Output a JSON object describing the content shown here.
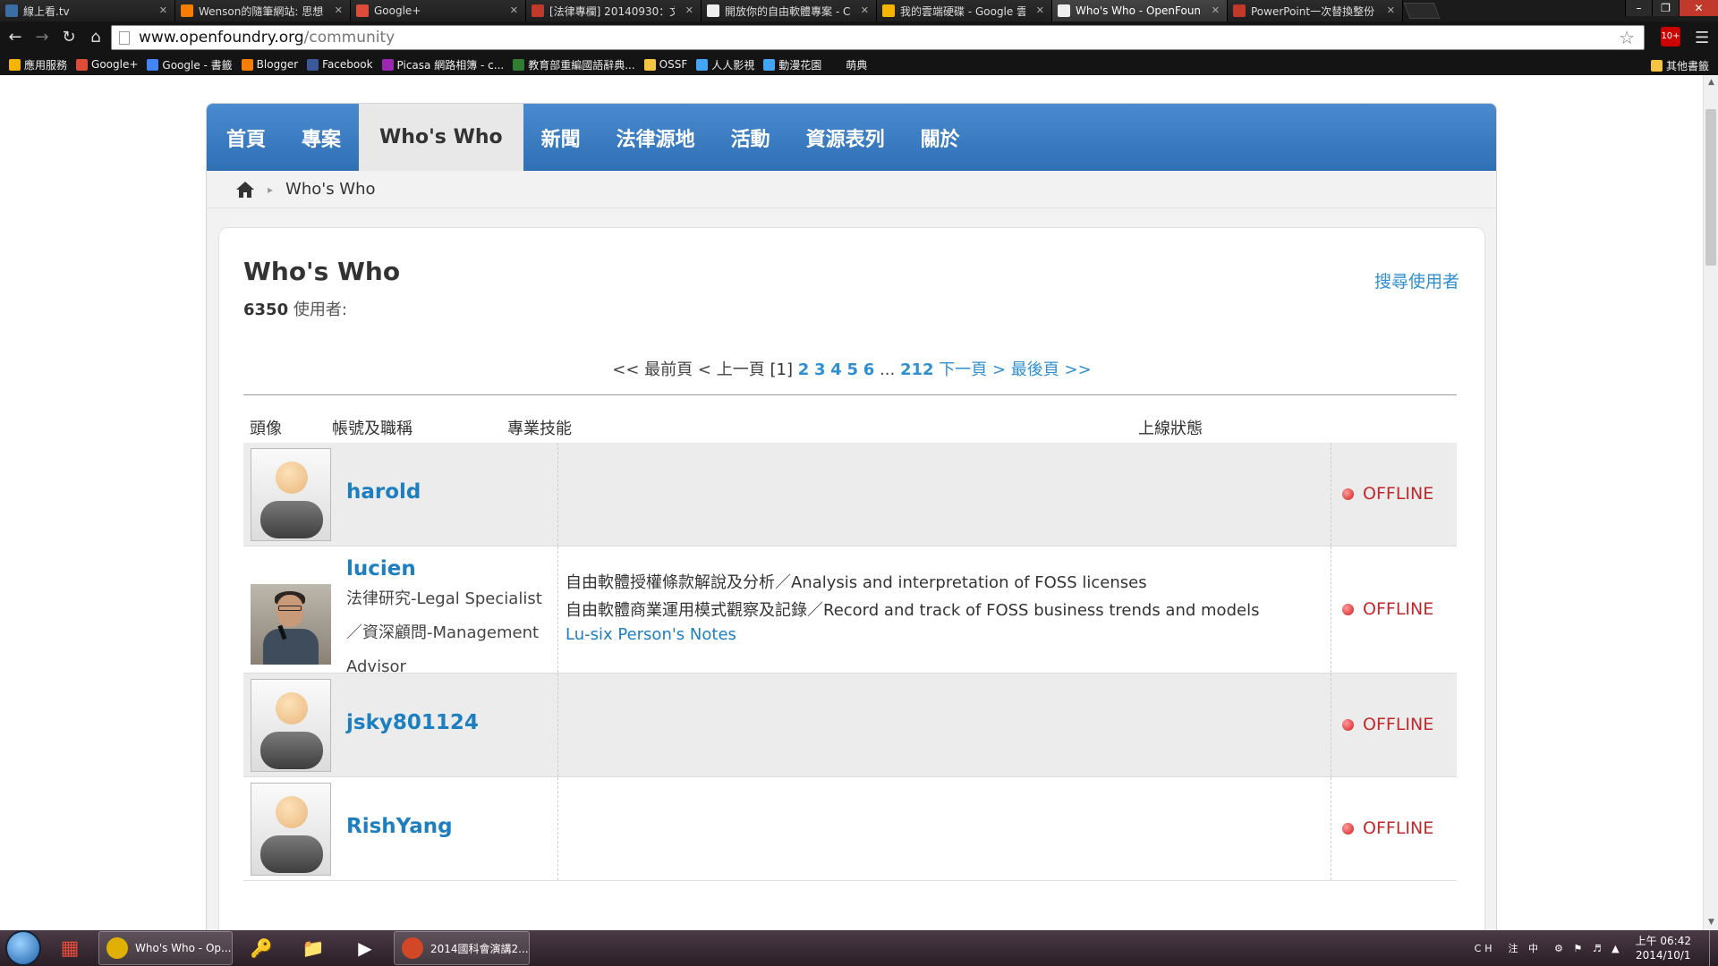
{
  "browser": {
    "tabs": [
      {
        "label": "線上看.tv",
        "icon_color": "#3a6ea5"
      },
      {
        "label": "Wenson的隨筆網站: 思想",
        "icon_color": "#f57d00"
      },
      {
        "label": "Google+",
        "icon_color": "#dd4b39"
      },
      {
        "label": "[法律專欄] 20140930：文",
        "icon_color": "#c0392b"
      },
      {
        "label": "開放你的自由軟體專案 - C",
        "icon_color": "#eeeeee"
      },
      {
        "label": "我的雲端硬碟 - Google 雲",
        "icon_color": "#f4b400"
      },
      {
        "label": "Who's Who - OpenFoun",
        "icon_color": "#eeeeee"
      },
      {
        "label": "PowerPoint一次替換整份",
        "icon_color": "#c0392b"
      }
    ],
    "url_host": "www.openfoundry.org",
    "url_path": "/community",
    "ext_badge": "10+",
    "bookmarks": [
      {
        "label": "應用服務",
        "icon_color": "#f4b400"
      },
      {
        "label": "Google+",
        "icon_color": "#dd4b39"
      },
      {
        "label": "Google - 書籤",
        "icon_color": "#4285f4"
      },
      {
        "label": "Blogger",
        "icon_color": "#f57d00"
      },
      {
        "label": "Facebook",
        "icon_color": "#3b5998"
      },
      {
        "label": "Picasa 網路相簿 - c...",
        "icon_color": "#9c27b0"
      },
      {
        "label": "教育部重編國語辭典...",
        "icon_color": "#2e7d32"
      },
      {
        "label": "OSSF",
        "icon_color": "#f4c542"
      },
      {
        "label": "人人影視",
        "icon_color": "#42a5f5"
      },
      {
        "label": "動漫花園",
        "icon_color": "#42a5f5"
      },
      {
        "label": "萌典",
        "icon_color": "#141414"
      }
    ],
    "other_bookmarks": "其他書籤"
  },
  "site": {
    "nav": [
      "首頁",
      "專案",
      "Who's Who",
      "新聞",
      "法律源地",
      "活動",
      "資源表列",
      "關於"
    ],
    "nav_active": 2,
    "breadcrumb": "Who's Who"
  },
  "directory": {
    "title": "Who's Who",
    "user_count": "6350",
    "user_count_label": "使用者:",
    "search_link": "搜尋使用者",
    "pager": {
      "first": "<< 最前頁",
      "prev": "< 上一頁",
      "current": "[1]",
      "pages": [
        "2",
        "3",
        "4",
        "5",
        "6"
      ],
      "ellipsis": "...",
      "last_page": "212",
      "next": "下一頁 >",
      "last": "最後頁 >>"
    },
    "columns": {
      "avatar": "頭像",
      "account": "帳號及職稱",
      "skills": "專業技能",
      "status": "上線狀態"
    },
    "users": [
      {
        "username": "harold",
        "title_lines": [],
        "skills": [],
        "links": [],
        "status": "OFFLINE",
        "avatar": "default"
      },
      {
        "username": "lucien",
        "title_lines": [
          "法律研究-Legal Specialist",
          "／資深顧問-Management",
          "Advisor"
        ],
        "skills": [
          "自由軟體授權條款解說及分析／Analysis and interpretation of FOSS licenses",
          "自由軟體商業運用模式觀察及記錄／Record and track of FOSS business trends and models"
        ],
        "links": [
          "Lu-six Person's Notes"
        ],
        "status": "OFFLINE",
        "avatar": "photo"
      },
      {
        "username": "jsky801124",
        "title_lines": [],
        "skills": [],
        "links": [],
        "status": "OFFLINE",
        "avatar": "default"
      },
      {
        "username": "RishYang",
        "title_lines": [],
        "skills": [],
        "links": [],
        "status": "OFFLINE",
        "avatar": "default"
      }
    ]
  },
  "taskbar": {
    "tasks": [
      {
        "label": "Who's Who - Op...",
        "icon_color": "#e0b000"
      },
      {
        "label": "2014國科會演講2...",
        "icon_color": "#d24726"
      }
    ],
    "tray_lang": "CH",
    "tray_ime": "注 中",
    "clock_time": "上午 06:42",
    "clock_date": "2014/10/1"
  }
}
